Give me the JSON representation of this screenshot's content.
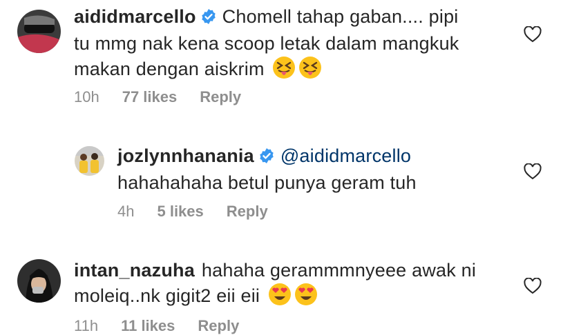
{
  "comments": [
    {
      "username": "aididmarcello",
      "verified": true,
      "lines": [
        "Chomell tahap gaban.... pipi",
        "tu mmg nak kena scoop letak dalam mangkuk",
        "makan dengan aiskrim"
      ],
      "time": "10h",
      "likes": "77 likes",
      "reply": "Reply"
    },
    {
      "username": "jozlynnhanania",
      "verified": true,
      "mention": "@aididmarcello",
      "lines": [
        "hahahahaha betul punya geram tuh"
      ],
      "time": "4h",
      "likes": "5 likes",
      "reply": "Reply"
    },
    {
      "username": "intan_nazuha",
      "verified": false,
      "lines": [
        "hahaha gerammmnyeee awak ni",
        "moleiq..nk gigit2 eii eii"
      ],
      "time": "11h",
      "likes": "11 likes",
      "reply": "Reply"
    }
  ],
  "icons": {
    "verified_color": "#3897f0",
    "heart": "heart-outline",
    "emoji_1": "squinting-tongue-emoji",
    "emoji_2": "heart-eyes-emoji"
  }
}
